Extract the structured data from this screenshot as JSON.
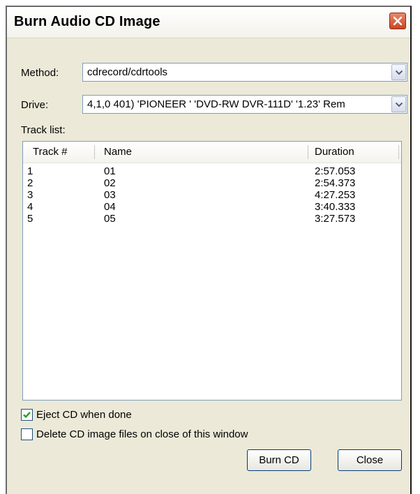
{
  "dialog": {
    "title": "Burn Audio CD Image"
  },
  "method": {
    "label": "Method:",
    "value": "cdrecord/cdrtools"
  },
  "drive": {
    "label": "Drive:",
    "value": "4,1,0 401) 'PIONEER ' 'DVD-RW  DVR-111D' '1.23' Rem"
  },
  "tracklist": {
    "label": "Track list:",
    "columns": [
      "Track #",
      "Name",
      "Duration"
    ],
    "rows": [
      {
        "track": "1",
        "name": "01",
        "duration": "2:57.053"
      },
      {
        "track": "2",
        "name": "02",
        "duration": "2:54.373"
      },
      {
        "track": "3",
        "name": "03",
        "duration": "4:27.253"
      },
      {
        "track": "4",
        "name": "04",
        "duration": "3:40.333"
      },
      {
        "track": "5",
        "name": "05",
        "duration": "3:27.573"
      }
    ]
  },
  "options": {
    "eject": {
      "label": "Eject CD when done",
      "checked": true
    },
    "delete": {
      "label": "Delete CD image files on close of this window",
      "checked": false
    }
  },
  "buttons": {
    "burn": "Burn CD",
    "close": "Close"
  },
  "icons": {
    "close": "close-icon",
    "dropdown": "chevron-down-icon",
    "check": "check-icon"
  },
  "colors": {
    "dialog_bg": "#ece9d8",
    "close_button": "#c94622",
    "checkmark": "#21a121",
    "field_border": "#7f9db9"
  }
}
